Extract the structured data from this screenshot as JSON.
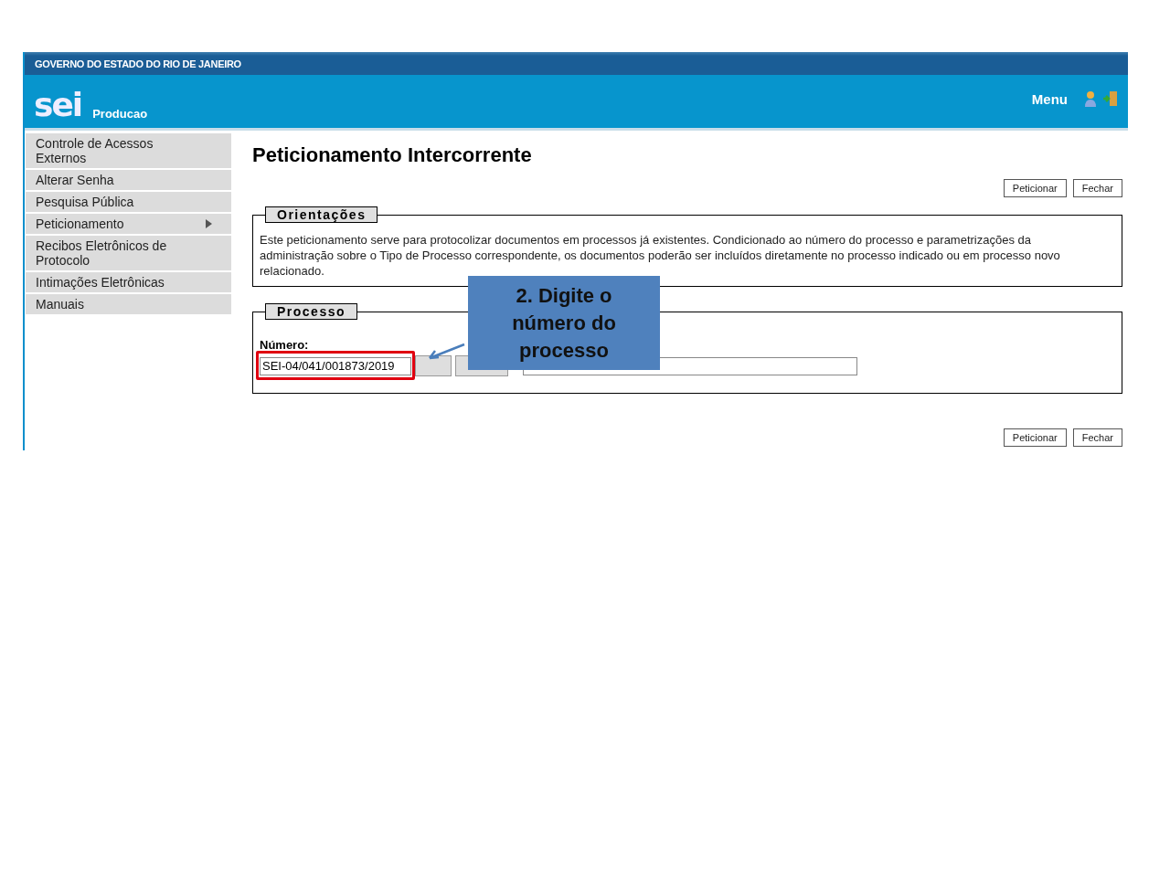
{
  "header": {
    "government": "GOVERNO DO ESTADO DO RIO DE JANEIRO",
    "logo": "sei",
    "environment": "Producao",
    "menu": "Menu"
  },
  "sidebar": {
    "items": [
      {
        "label": "Controle de Acessos Externos",
        "has_submenu": false
      },
      {
        "label": "Alterar Senha",
        "has_submenu": false
      },
      {
        "label": "Pesquisa Pública",
        "has_submenu": false
      },
      {
        "label": "Peticionamento",
        "has_submenu": true
      },
      {
        "label": "Recibos Eletrônicos de Protocolo",
        "has_submenu": false
      },
      {
        "label": "Intimações Eletrônicas",
        "has_submenu": false
      },
      {
        "label": "Manuais",
        "has_submenu": false
      }
    ]
  },
  "page_title": "Peticionamento Intercorrente",
  "top_buttons": [
    "Peticionar",
    "Fechar"
  ],
  "orientacoes": {
    "legend": "Orientações",
    "text": "Este peticionamento serve para protocolizar documentos em processos já existentes. Condicionado ao número do processo e parametrizações da administração sobre o Tipo de Processo correspondente, os documentos poderão ser incluídos diretamente no processo indicado ou em processo novo relacionado."
  },
  "processo": {
    "legend": "Processo",
    "label": "Número:",
    "value": "SEI-04/041/001873/2019"
  },
  "bottom_buttons": [
    "Peticionar",
    "Fechar"
  ],
  "callout": {
    "text": "2. Digite o número do processo"
  }
}
